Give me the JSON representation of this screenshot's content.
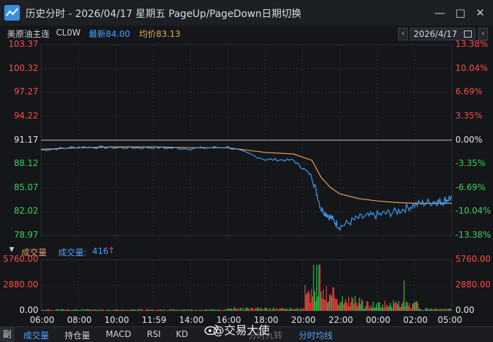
{
  "window": {
    "title": "历史分时 - 2026/04/17 星期五 PageUp/PageDown日期切换",
    "min_label": "—",
    "max_label": "□",
    "close_label": "✕"
  },
  "info": {
    "name": "美原油主连",
    "code": "CL0W",
    "last_label": "最新84.00",
    "avg_label": "均价83.13"
  },
  "date_picker": {
    "prev": "‹",
    "value": "2026/4/17",
    "next": "›"
  },
  "price_axis": [
    {
      "value": "103.37",
      "pct": "13.38%",
      "color": "red"
    },
    {
      "value": "100.32",
      "pct": "10.04%",
      "color": "red"
    },
    {
      "value": "97.27",
      "pct": "6.69%",
      "color": "red"
    },
    {
      "value": "94.22",
      "pct": "3.35%",
      "color": "red"
    },
    {
      "value": "91.17",
      "pct": "0.00%",
      "color": "white"
    },
    {
      "value": "88.12",
      "pct": "-3.35%",
      "color": "green"
    },
    {
      "value": "85.07",
      "pct": "-6.69%",
      "color": "green"
    },
    {
      "value": "82.02",
      "pct": "-10.04%",
      "color": "green"
    },
    {
      "value": "78.97",
      "pct": "-13.38%",
      "color": "green"
    }
  ],
  "volume": {
    "toggle": "▼",
    "title": "成交量",
    "label": "成交量:",
    "value": "416",
    "arrow": "↑",
    "axis": [
      {
        "left": "5760.00",
        "right": "5760.00"
      },
      {
        "left": "2880.00",
        "right": "2880.00"
      },
      {
        "left": "0.00",
        "right": "0.00"
      }
    ]
  },
  "time_axis": [
    "06:00",
    "08:00",
    "10:00",
    "11:59",
    "14:00",
    "16:00",
    "18:00",
    "20:00",
    "22:00",
    "00:00",
    "02:00",
    "05:00"
  ],
  "tabs": {
    "side": "副",
    "items": [
      "成交量",
      "持仓量",
      "MACD",
      "RSI",
      "KD",
      "分时均线"
    ],
    "hidden_partial": "分时九转"
  },
  "watermark": "@交易大使",
  "colors": {
    "price_line": "#3d9bf0",
    "avg_line": "#e8a25a",
    "up": "#ff3b3b",
    "down": "#2fbf4a",
    "background": "#14161a"
  },
  "chart_data": {
    "type": "line",
    "x": [
      "06:00",
      "08:00",
      "10:00",
      "11:59",
      "14:00",
      "16:00",
      "18:00",
      "19:30",
      "20:30",
      "21:00",
      "21:30",
      "22:00",
      "23:00",
      "00:00",
      "01:00",
      "02:00",
      "03:00",
      "04:00",
      "05:00"
    ],
    "series": [
      {
        "key": "price",
        "values": [
          89.9,
          90.3,
          90.2,
          90.2,
          90.1,
          90.3,
          88.7,
          88.6,
          86.6,
          82.4,
          81.3,
          80.1,
          81.2,
          81.6,
          82.0,
          82.9,
          83.3,
          83.3,
          83.9
        ]
      },
      {
        "key": "avg",
        "values": [
          90.0,
          90.2,
          90.3,
          90.3,
          90.2,
          90.2,
          89.6,
          89.4,
          88.6,
          86.4,
          85.1,
          84.3,
          83.7,
          83.4,
          83.2,
          83.1,
          83.1,
          83.1,
          83.1
        ]
      }
    ],
    "ylim": [
      78.97,
      103.37
    ],
    "ylabel": "",
    "xlabel": ""
  }
}
